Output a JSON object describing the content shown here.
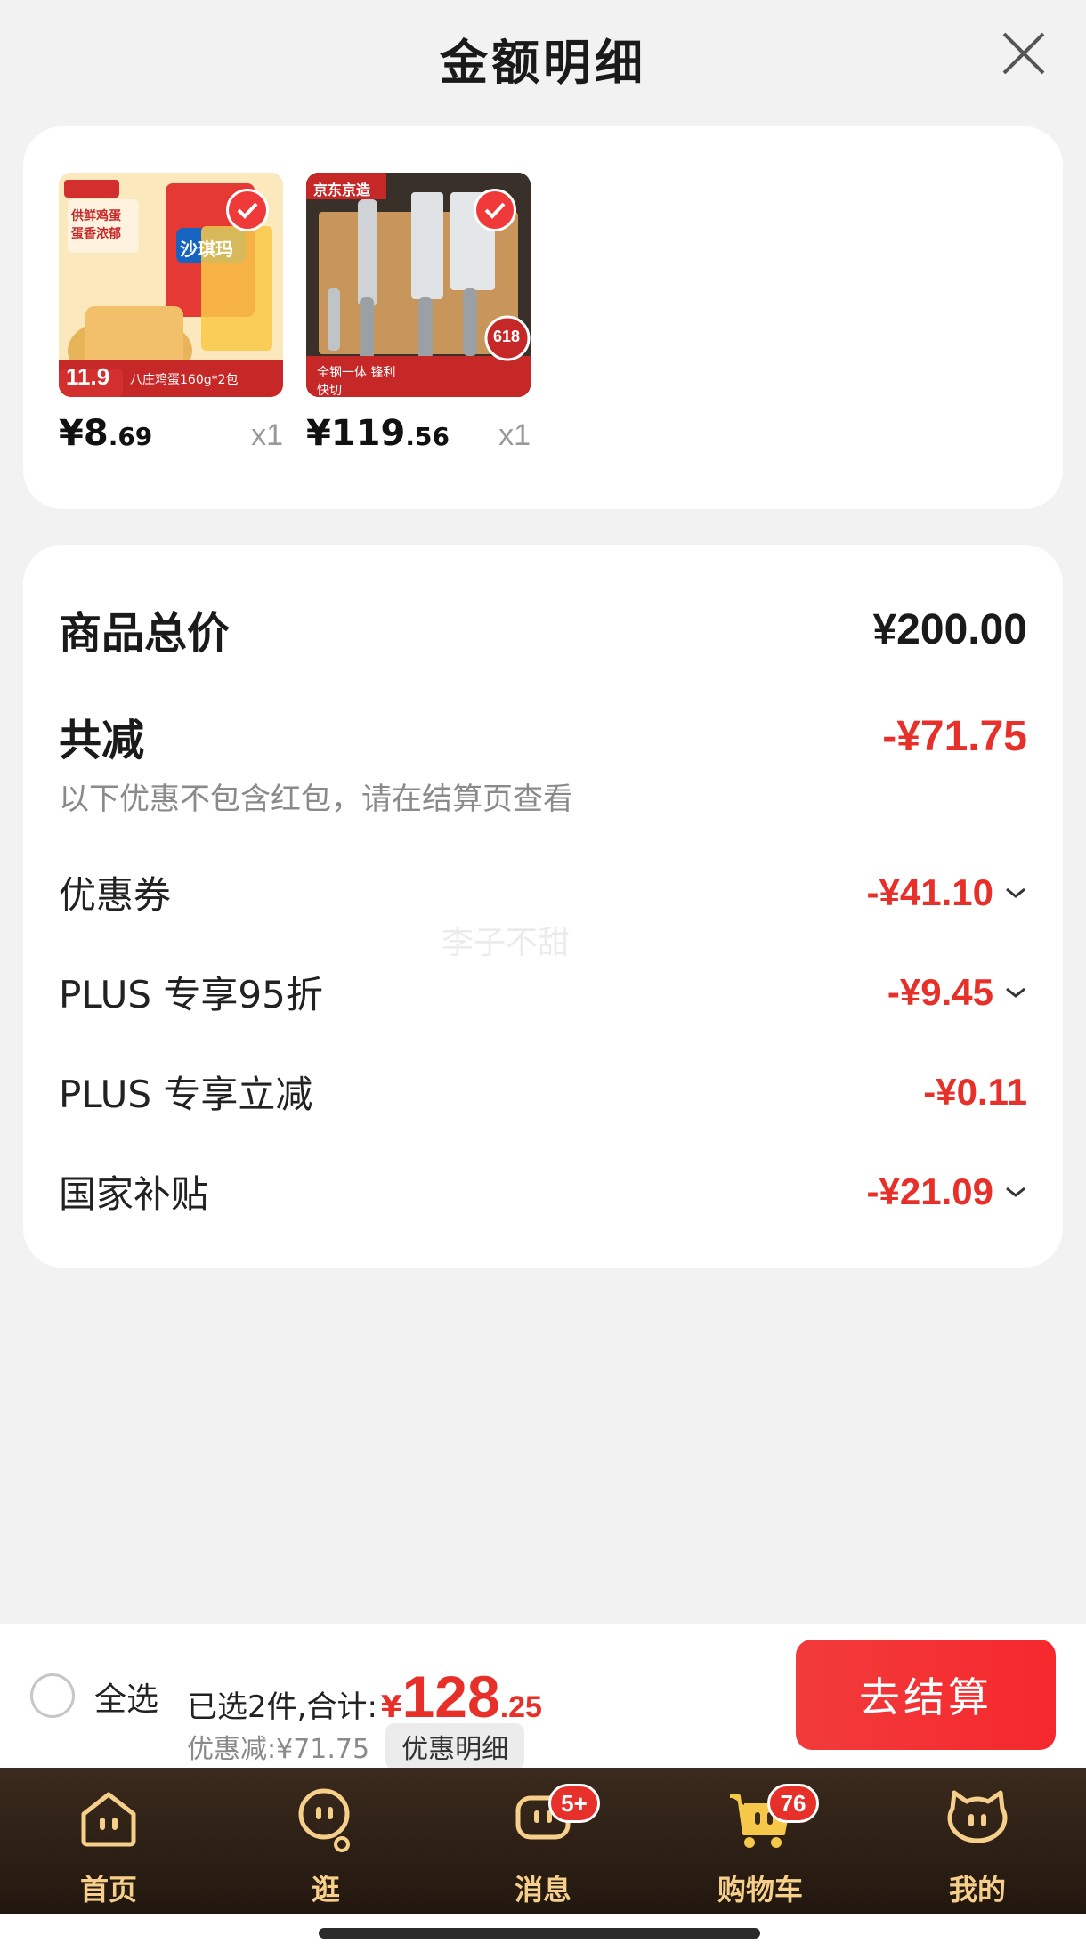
{
  "sheet": {
    "title": "金额明细",
    "close_icon": "close-icon"
  },
  "products": [
    {
      "name": "沙琪玛",
      "thumb_top_text": "供鲜鸡蛋 蛋香浓郁",
      "thumb_price_tag": "11.9",
      "thumb_bottom_text": "八庄鸡蛋160g*2包",
      "yen": "¥",
      "price_int": "8",
      "price_dec": ".69",
      "qty": "x1"
    },
    {
      "name": "刀具套装",
      "thumb_top_text": "京东京造",
      "thumb_price_tag": "618",
      "thumb_bottom_text": "全钢一体 锋利快切",
      "yen": "¥",
      "price_int": "119",
      "price_dec": ".56",
      "qty": "x1"
    }
  ],
  "summary": {
    "goods_total_label": "商品总价",
    "goods_total_value": "¥200.00",
    "total_off_label": "共减",
    "total_off_value": "-¥71.75",
    "hint": "以下优惠不包含红包，请在结算页查看",
    "lines": [
      {
        "label": "优惠券",
        "value": "-¥41.10",
        "expandable": true
      },
      {
        "label": "PLUS 专享95折",
        "value": "-¥9.45",
        "expandable": true
      },
      {
        "label": "PLUS 专享立减",
        "value": "-¥0.11",
        "expandable": false
      },
      {
        "label": "国家补贴",
        "value": "-¥21.09",
        "expandable": true
      }
    ],
    "watermark": "李子不甜"
  },
  "checkout": {
    "select_all": "全选",
    "selected_text": "已选2件,合计:",
    "total_yen": "¥",
    "total_int": "128",
    "total_dec": ".25",
    "discount_text": "优惠减:¥71.75",
    "detail_chip": "优惠明细",
    "checkout_button": "去结算"
  },
  "tabbar": {
    "tabs": [
      {
        "label": "首页",
        "icon": "home-icon",
        "badge": ""
      },
      {
        "label": "逛",
        "icon": "browse-icon",
        "badge": ""
      },
      {
        "label": "消息",
        "icon": "message-icon",
        "badge": "5+"
      },
      {
        "label": "购物车",
        "icon": "cart-icon",
        "badge": "76"
      },
      {
        "label": "我的",
        "icon": "profile-icon",
        "badge": ""
      }
    ]
  },
  "colors": {
    "accent_red": "#e8302a",
    "tab_gold": "#f6cf8a",
    "tabbar_bg": "#2b1e14"
  }
}
